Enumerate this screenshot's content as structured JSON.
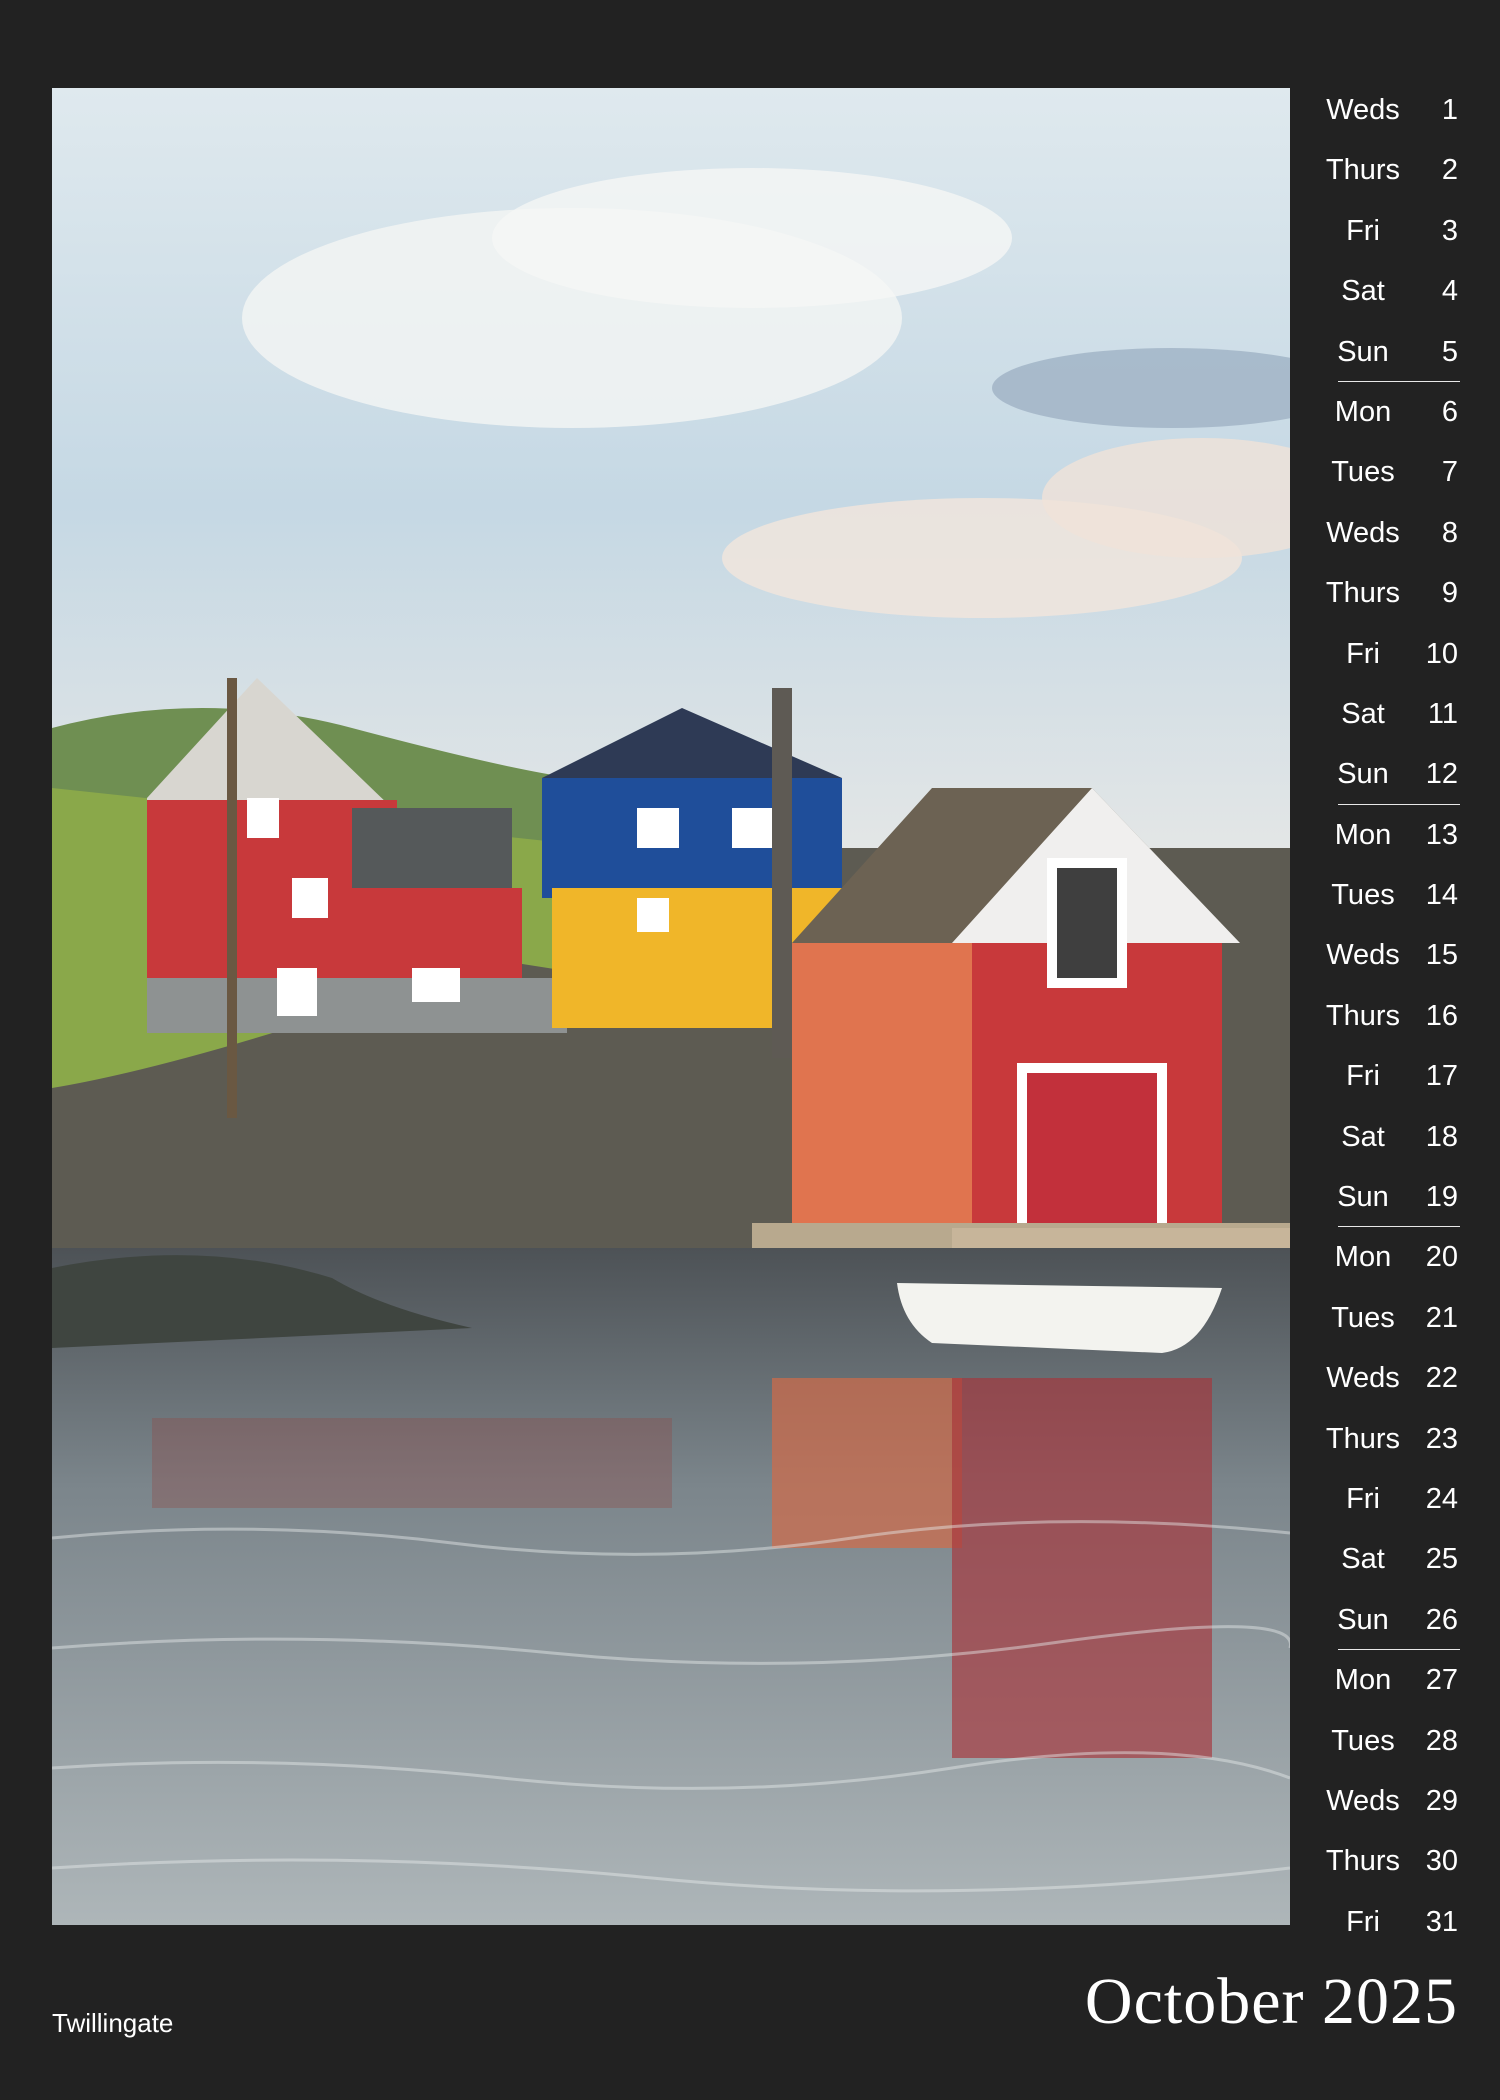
{
  "month_title": "October 2025",
  "caption": "Twillingate",
  "photo": {
    "subject": "harbour-houses-photo"
  },
  "days": [
    {
      "name": "Weds",
      "num": "1"
    },
    {
      "name": "Thurs",
      "num": "2"
    },
    {
      "name": "Fri",
      "num": "3"
    },
    {
      "name": "Sat",
      "num": "4"
    },
    {
      "name": "Sun",
      "num": "5",
      "week_end": true
    },
    {
      "name": "Mon",
      "num": "6"
    },
    {
      "name": "Tues",
      "num": "7"
    },
    {
      "name": "Weds",
      "num": "8"
    },
    {
      "name": "Thurs",
      "num": "9"
    },
    {
      "name": "Fri",
      "num": "10"
    },
    {
      "name": "Sat",
      "num": "11"
    },
    {
      "name": "Sun",
      "num": "12",
      "week_end": true
    },
    {
      "name": "Mon",
      "num": "13"
    },
    {
      "name": "Tues",
      "num": "14"
    },
    {
      "name": "Weds",
      "num": "15"
    },
    {
      "name": "Thurs",
      "num": "16"
    },
    {
      "name": "Fri",
      "num": "17"
    },
    {
      "name": "Sat",
      "num": "18"
    },
    {
      "name": "Sun",
      "num": "19",
      "week_end": true
    },
    {
      "name": "Mon",
      "num": "20"
    },
    {
      "name": "Tues",
      "num": "21"
    },
    {
      "name": "Weds",
      "num": "22"
    },
    {
      "name": "Thurs",
      "num": "23"
    },
    {
      "name": "Fri",
      "num": "24"
    },
    {
      "name": "Sat",
      "num": "25"
    },
    {
      "name": "Sun",
      "num": "26",
      "week_end": true
    },
    {
      "name": "Mon",
      "num": "27"
    },
    {
      "name": "Tues",
      "num": "28"
    },
    {
      "name": "Weds",
      "num": "29"
    },
    {
      "name": "Thurs",
      "num": "30"
    },
    {
      "name": "Fri",
      "num": "31"
    }
  ],
  "colors": {
    "background": "#222222",
    "text": "#ffffff",
    "barn_red": "#c8393b",
    "house_blue": "#1f4e9a",
    "house_yellow": "#f0b629",
    "water": "#6f7a80"
  }
}
